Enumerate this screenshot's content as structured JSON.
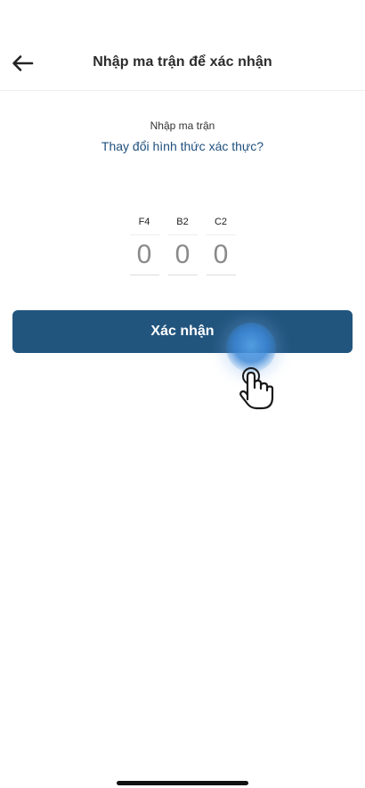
{
  "header": {
    "back_icon": "arrow-left-icon",
    "title": "Nhập ma trận để xác nhận"
  },
  "matrix": {
    "label": "Nhập ma trận",
    "change_link": "Thay đổi hình thức xác thực?",
    "cells": [
      {
        "code": "F4",
        "placeholder": "0"
      },
      {
        "code": "B2",
        "placeholder": "0"
      },
      {
        "code": "C2",
        "placeholder": "0"
      }
    ]
  },
  "confirm_button": {
    "label": "Xác nhận",
    "color": "#22557e"
  },
  "overlay": {
    "tap_indicator_icon": "tap-hand-icon"
  }
}
